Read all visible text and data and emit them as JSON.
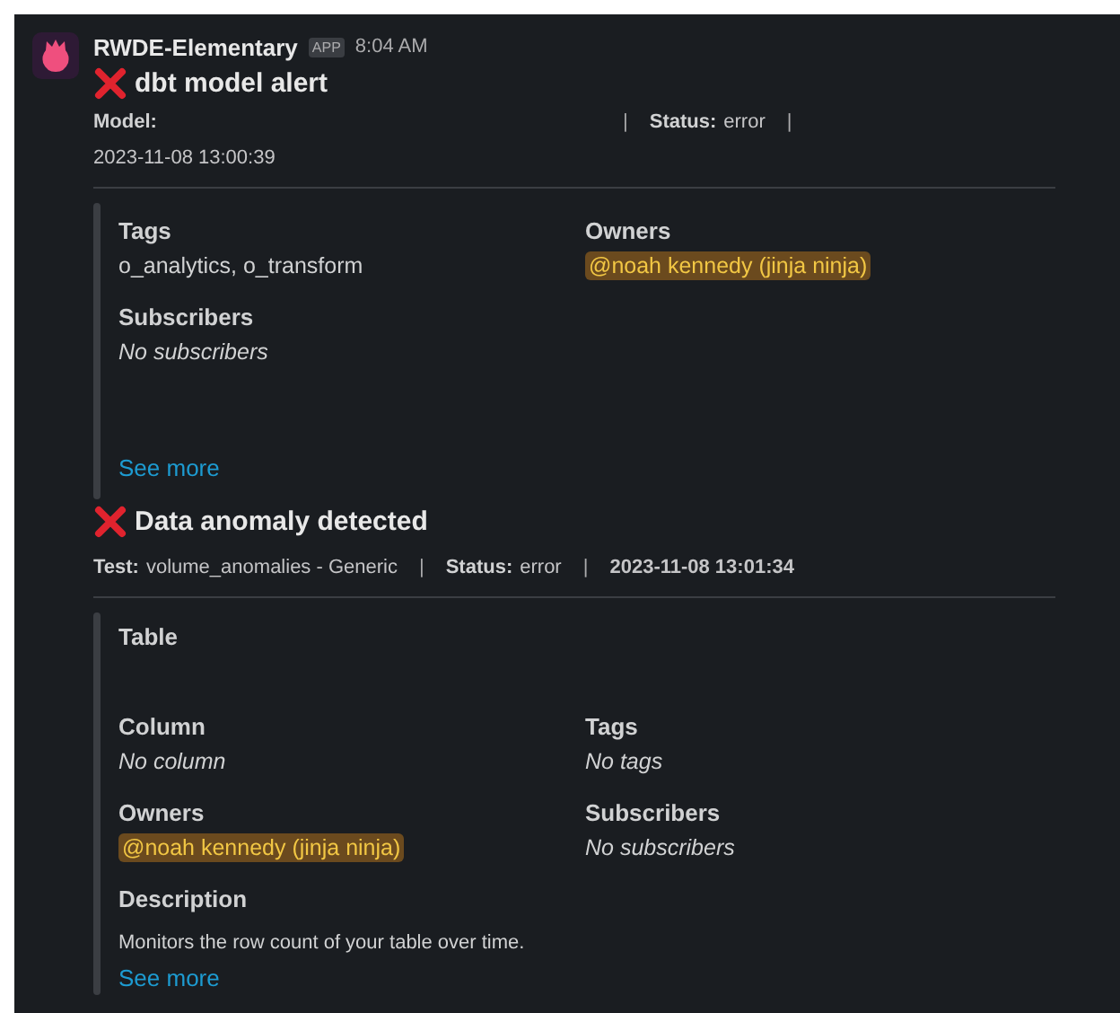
{
  "message": {
    "sender": "RWDE-Elementary",
    "badge": "APP",
    "time": "8:04 AM"
  },
  "alerts": [
    {
      "title": "dbt model alert",
      "meta_lines": [
        [
          {
            "kind": "field",
            "label": "Model:"
          },
          {
            "kind": "sep",
            "text": "|"
          },
          {
            "kind": "field",
            "label": "Status:",
            "value": "error"
          },
          {
            "kind": "sep",
            "text": "|"
          }
        ],
        [
          {
            "kind": "text",
            "text": "2023-11-08 13:00:39"
          }
        ]
      ],
      "rows": [
        [
          {
            "label": "Tags",
            "kind": "plain",
            "value": "o_analytics, o_transform"
          },
          {
            "label": "Owners",
            "kind": "mention",
            "value": "@noah kennedy (jinja ninja)"
          }
        ],
        [
          {
            "label": "Subscribers",
            "kind": "italic",
            "value": "No subscribers"
          }
        ]
      ],
      "link": "See more"
    },
    {
      "title": "Data anomaly detected",
      "meta_lines": [
        [
          {
            "kind": "field",
            "label": "Test:",
            "value": "volume_anomalies - Generic"
          },
          {
            "kind": "sep",
            "text": "|"
          },
          {
            "kind": "field",
            "label": "Status:",
            "value": "error"
          },
          {
            "kind": "sep",
            "text": "|"
          },
          {
            "kind": "text",
            "text": "2023-11-08 13:01:34"
          }
        ]
      ],
      "rows": [
        [
          {
            "label": "Table",
            "kind": "empty"
          }
        ],
        [
          {
            "label": "Column",
            "kind": "italic",
            "value": "No column"
          },
          {
            "label": "Tags",
            "kind": "italic",
            "value": "No tags"
          }
        ],
        [
          {
            "label": "Owners",
            "kind": "mention",
            "value": "@noah kennedy (jinja ninja)"
          },
          {
            "label": "Subscribers",
            "kind": "italic",
            "value": "No subscribers"
          }
        ],
        [
          {
            "label": "Description",
            "kind": "description",
            "value": "Monitors the row count of your table over time."
          }
        ]
      ],
      "link": "See more"
    }
  ]
}
